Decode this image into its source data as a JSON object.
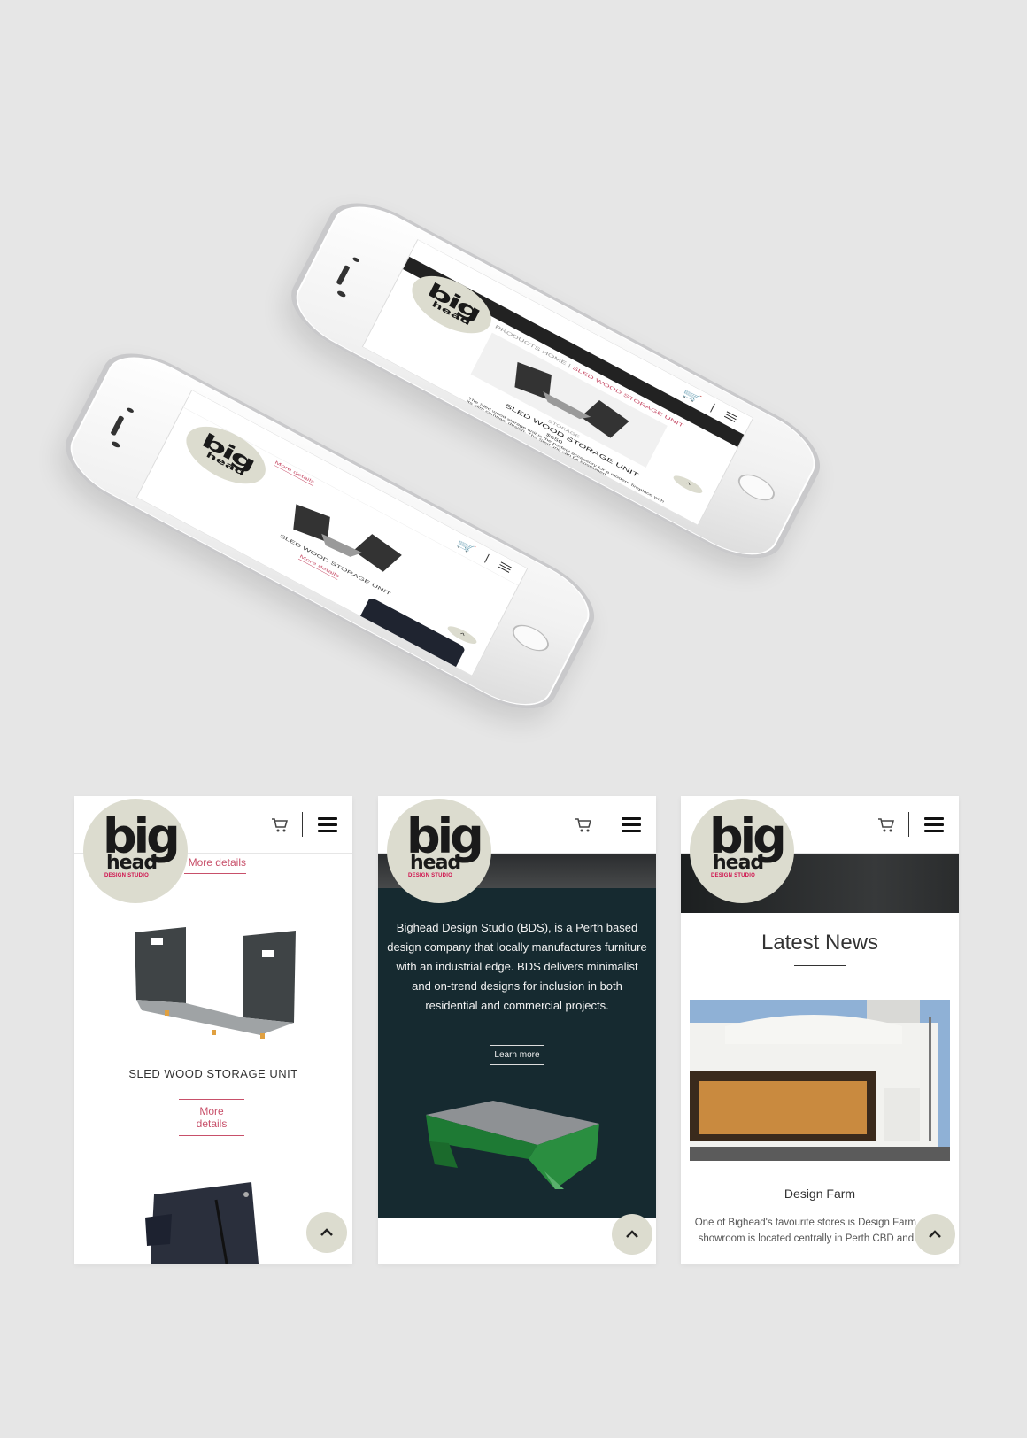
{
  "brand": {
    "logo_big": "big",
    "logo_head": "head",
    "logo_studio": "DESIGN STUDIO",
    "accent_color": "#c8506a",
    "logo_bg": "#dcdccf"
  },
  "header": {
    "cart_icon": "cart-icon",
    "menu_icon": "hamburger-menu-icon"
  },
  "phone_back": {
    "breadcrumb_home": "PRODUCTS HOME",
    "breadcrumb_sep": "|",
    "breadcrumb_current": "SLED WOOD STORAGE UNIT",
    "category": "STORAGE",
    "product_title": "SLED WOOD STORAGE UNIT",
    "price": "$650",
    "description": "The Sled wood storage unit is the perfect accessory for a modern fireplace with its slim compact design. The Sled unit can be positioned"
  },
  "phone_front": {
    "top_link": "More details",
    "product_title": "SLED WOOD STORAGE UNIT",
    "link": "More details"
  },
  "screen1": {
    "top_link": "More details",
    "product_title": "SLED WOOD STORAGE UNIT",
    "link": "More details"
  },
  "screen2": {
    "intro": "Bighead Design Studio (BDS), is a Perth based design company that locally manufactures furniture with an industrial edge. BDS delivers minimalist and on-trend designs for inclusion in both residential and commercial projects.",
    "button": "Learn more"
  },
  "screen3": {
    "section_title": "Latest News",
    "article_title": "Design Farm",
    "article_excerpt": "One of Bighead's favourite stores is Design Farm. Their showroom is located centrally in Perth CBD and in the"
  }
}
